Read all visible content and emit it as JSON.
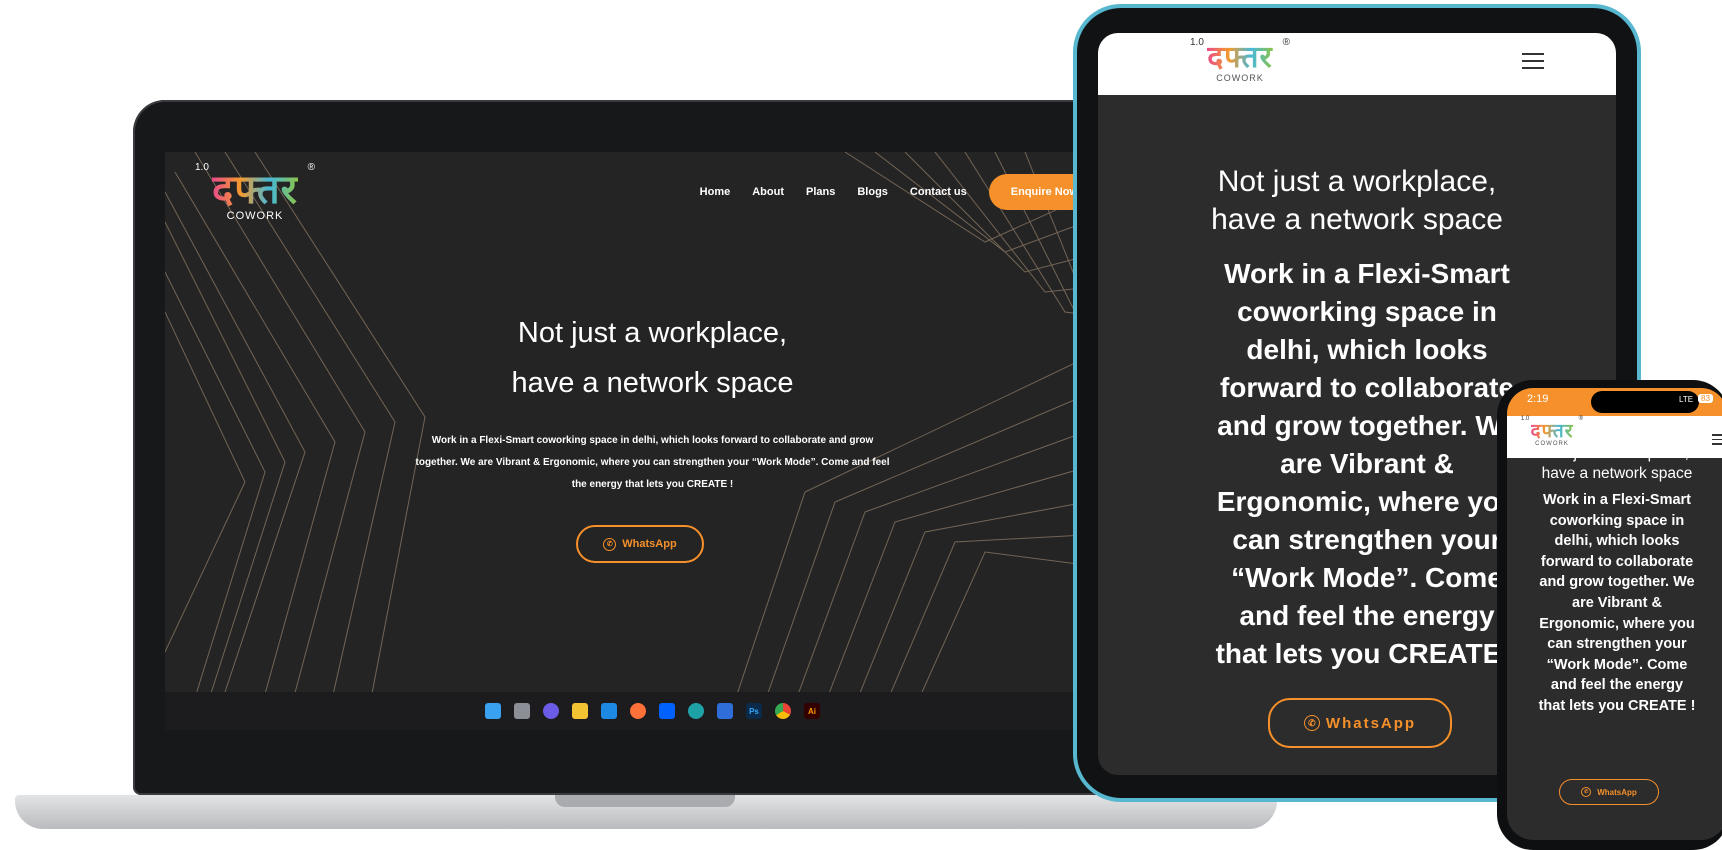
{
  "brand": {
    "version": "1.0",
    "name": "दफ्तर",
    "tagline": "COWORK",
    "registered": "®"
  },
  "nav": {
    "items": [
      "Home",
      "About",
      "Plans",
      "Blogs",
      "Contact us"
    ],
    "cta": "Enquire Now"
  },
  "hero": {
    "title_line1": "Not just a workplace,",
    "title_line2": "have a network space",
    "desktop_body": "Work in a Flexi-Smart coworking space in delhi, which looks forward to collaborate and grow together. We are Vibrant & Ergonomic, where you can strengthen your “Work Mode”. Come and feel the energy that lets you CREATE !",
    "whatsapp_label": "WhatsApp"
  },
  "tablet": {
    "title_lines": [
      "Not just a workplace,",
      "have a network space"
    ],
    "body_lines": [
      "Work in a Flexi-Smart",
      "coworking space in",
      "delhi, which looks",
      "forward to collaborate",
      "and grow together. We",
      "are Vibrant &",
      "Ergonomic, where you",
      "can strengthen your",
      "“Work Mode”. Come",
      "and feel the energy",
      "that lets you CREATE !"
    ]
  },
  "phone": {
    "time": "2:19",
    "network": "LTE",
    "battery": "83",
    "title_lines": [
      "Not just a workplace,",
      "have a network space"
    ],
    "body_lines": [
      "Work in a Flexi-Smart",
      "coworking space in",
      "delhi, which looks",
      "forward to collaborate",
      "and grow together. We",
      "are Vibrant &",
      "Ergonomic, where you",
      "can strengthen your",
      "“Work Mode”. Come",
      "and feel the energy",
      "that lets you CREATE !"
    ]
  },
  "taskbar": {
    "icons": [
      "windows-start",
      "task-view",
      "chat",
      "file-explorer",
      "mail",
      "firefox",
      "dropbox",
      "edge",
      "store",
      "photoshop",
      "chrome",
      "illustrator"
    ],
    "labels": {
      "photoshop": "Ps",
      "illustrator": "Ai"
    }
  },
  "colors": {
    "accent": "#f5902a",
    "background": "#242425",
    "line_art": "#b59a7c"
  }
}
